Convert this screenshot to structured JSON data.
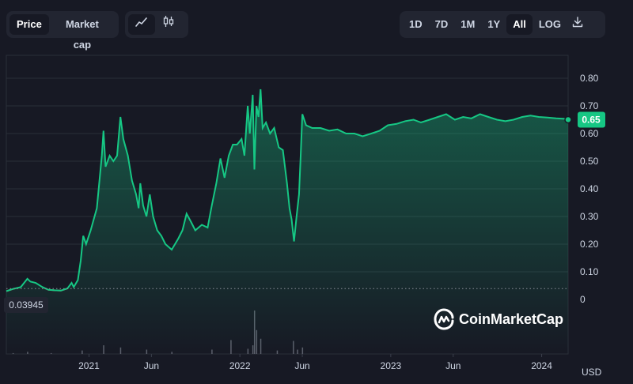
{
  "toolbar": {
    "type_tabs": [
      {
        "label": "Price",
        "active": true
      },
      {
        "label": "Market cap",
        "active": false
      }
    ],
    "view_icons": [
      "line-chart-icon",
      "candlestick-icon"
    ],
    "range_tabs": [
      {
        "label": "1D",
        "active": false
      },
      {
        "label": "7D",
        "active": false
      },
      {
        "label": "1M",
        "active": false
      },
      {
        "label": "1Y",
        "active": false
      },
      {
        "label": "All",
        "active": true
      },
      {
        "label": "LOG",
        "active": false
      }
    ],
    "download_icon": "download-icon"
  },
  "brand": {
    "name": "CoinMarketCap"
  },
  "colors": {
    "up": "#16c784",
    "down": "#ea3943",
    "background": "#171924",
    "grid": "#2a2e39"
  },
  "chart_data": {
    "type": "area",
    "currency": "USD",
    "start_price_label": "0.03945",
    "current_price_label": "0.65",
    "ylim": [
      0,
      0.8
    ],
    "y_ticks": [
      "0",
      "0.10",
      "0.20",
      "0.30",
      "0.40",
      "0.50",
      "0.60",
      "0.70",
      "0.80"
    ],
    "x_ticks": [
      "2021",
      "Jun",
      "2022",
      "Jun",
      "2023",
      "Jun",
      "2024"
    ],
    "x_tick_dates": [
      "2021-01-01",
      "2021-06-01",
      "2022-01-01",
      "2022-06-01",
      "2023-01-01",
      "2023-06-01",
      "2024-01-01"
    ],
    "xlim": [
      "2020-06-15",
      "2024-03-05"
    ],
    "series": [
      {
        "points": [
          [
            "2020-06-15",
            0.03
          ],
          [
            "2020-07-01",
            0.038
          ],
          [
            "2020-07-20",
            0.045
          ],
          [
            "2020-08-05",
            0.075
          ],
          [
            "2020-08-12",
            0.065
          ],
          [
            "2020-08-25",
            0.06
          ],
          [
            "2020-09-10",
            0.045
          ],
          [
            "2020-09-25",
            0.035
          ],
          [
            "2020-10-10",
            0.033
          ],
          [
            "2020-10-25",
            0.032
          ],
          [
            "2020-11-10",
            0.04
          ],
          [
            "2020-11-20",
            0.06
          ],
          [
            "2020-11-25",
            0.045
          ],
          [
            "2020-12-05",
            0.07
          ],
          [
            "2020-12-12",
            0.14
          ],
          [
            "2020-12-18",
            0.23
          ],
          [
            "2020-12-25",
            0.2
          ],
          [
            "2021-01-05",
            0.25
          ],
          [
            "2021-01-20",
            0.33
          ],
          [
            "2021-02-01",
            0.52
          ],
          [
            "2021-02-05",
            0.61
          ],
          [
            "2021-02-10",
            0.48
          ],
          [
            "2021-02-20",
            0.52
          ],
          [
            "2021-03-01",
            0.5
          ],
          [
            "2021-03-10",
            0.52
          ],
          [
            "2021-03-18",
            0.66
          ],
          [
            "2021-03-25",
            0.58
          ],
          [
            "2021-04-05",
            0.52
          ],
          [
            "2021-04-15",
            0.43
          ],
          [
            "2021-04-25",
            0.38
          ],
          [
            "2021-05-01",
            0.33
          ],
          [
            "2021-05-05",
            0.42
          ],
          [
            "2021-05-12",
            0.34
          ],
          [
            "2021-05-20",
            0.3
          ],
          [
            "2021-05-28",
            0.38
          ],
          [
            "2021-06-05",
            0.3
          ],
          [
            "2021-06-15",
            0.25
          ],
          [
            "2021-06-25",
            0.23
          ],
          [
            "2021-07-05",
            0.2
          ],
          [
            "2021-07-20",
            0.18
          ],
          [
            "2021-08-05",
            0.22
          ],
          [
            "2021-08-15",
            0.25
          ],
          [
            "2021-08-25",
            0.31
          ],
          [
            "2021-09-05",
            0.28
          ],
          [
            "2021-09-15",
            0.25
          ],
          [
            "2021-10-01",
            0.27
          ],
          [
            "2021-10-15",
            0.26
          ],
          [
            "2021-10-25",
            0.34
          ],
          [
            "2021-11-05",
            0.42
          ],
          [
            "2021-11-15",
            0.51
          ],
          [
            "2021-11-25",
            0.44
          ],
          [
            "2021-12-05",
            0.52
          ],
          [
            "2021-12-15",
            0.56
          ],
          [
            "2021-12-25",
            0.56
          ],
          [
            "2022-01-05",
            0.58
          ],
          [
            "2022-01-12",
            0.52
          ],
          [
            "2022-01-20",
            0.7
          ],
          [
            "2022-01-25",
            0.6
          ],
          [
            "2022-02-01",
            0.74
          ],
          [
            "2022-02-05",
            0.47
          ],
          [
            "2022-02-10",
            0.7
          ],
          [
            "2022-02-15",
            0.66
          ],
          [
            "2022-02-20",
            0.76
          ],
          [
            "2022-02-25",
            0.62
          ],
          [
            "2022-03-05",
            0.64
          ],
          [
            "2022-03-15",
            0.6
          ],
          [
            "2022-03-25",
            0.62
          ],
          [
            "2022-04-05",
            0.55
          ],
          [
            "2022-04-15",
            0.54
          ],
          [
            "2022-04-25",
            0.42
          ],
          [
            "2022-05-01",
            0.33
          ],
          [
            "2022-05-06",
            0.29
          ],
          [
            "2022-05-12",
            0.21
          ],
          [
            "2022-05-18",
            0.3
          ],
          [
            "2022-05-24",
            0.38
          ],
          [
            "2022-05-28",
            0.52
          ],
          [
            "2022-06-01",
            0.67
          ],
          [
            "2022-06-10",
            0.63
          ],
          [
            "2022-06-25",
            0.62
          ],
          [
            "2022-07-15",
            0.62
          ],
          [
            "2022-08-05",
            0.61
          ],
          [
            "2022-08-25",
            0.615
          ],
          [
            "2022-09-15",
            0.6
          ],
          [
            "2022-10-05",
            0.6
          ],
          [
            "2022-10-25",
            0.59
          ],
          [
            "2022-11-15",
            0.6
          ],
          [
            "2022-12-05",
            0.61
          ],
          [
            "2022-12-25",
            0.63
          ],
          [
            "2023-01-15",
            0.635
          ],
          [
            "2023-02-05",
            0.645
          ],
          [
            "2023-02-25",
            0.65
          ],
          [
            "2023-03-15",
            0.64
          ],
          [
            "2023-04-05",
            0.65
          ],
          [
            "2023-04-25",
            0.66
          ],
          [
            "2023-05-15",
            0.67
          ],
          [
            "2023-06-05",
            0.65
          ],
          [
            "2023-06-25",
            0.66
          ],
          [
            "2023-07-15",
            0.655
          ],
          [
            "2023-08-05",
            0.67
          ],
          [
            "2023-08-25",
            0.66
          ],
          [
            "2023-09-15",
            0.65
          ],
          [
            "2023-10-05",
            0.645
          ],
          [
            "2023-10-25",
            0.65
          ],
          [
            "2023-11-15",
            0.66
          ],
          [
            "2023-12-05",
            0.665
          ],
          [
            "2023-12-25",
            0.66
          ],
          [
            "2024-01-15",
            0.658
          ],
          [
            "2024-02-05",
            0.655
          ],
          [
            "2024-02-25",
            0.653
          ],
          [
            "2024-03-05",
            0.65
          ]
        ]
      }
    ],
    "volume": [
      [
        "2020-07-01",
        0.02
      ],
      [
        "2020-08-05",
        0.05
      ],
      [
        "2020-10-01",
        0.02
      ],
      [
        "2020-12-15",
        0.08
      ],
      [
        "2021-02-05",
        0.2
      ],
      [
        "2021-03-18",
        0.15
      ],
      [
        "2021-05-20",
        0.1
      ],
      [
        "2021-07-20",
        0.05
      ],
      [
        "2021-10-25",
        0.1
      ],
      [
        "2021-12-10",
        0.32
      ],
      [
        "2022-01-20",
        0.12
      ],
      [
        "2022-02-01",
        0.2
      ],
      [
        "2022-02-05",
        1.0
      ],
      [
        "2022-02-10",
        0.55
      ],
      [
        "2022-02-20",
        0.35
      ],
      [
        "2022-04-01",
        0.08
      ],
      [
        "2022-05-10",
        0.3
      ],
      [
        "2022-05-20",
        0.1
      ],
      [
        "2022-06-01",
        0.15
      ]
    ]
  }
}
